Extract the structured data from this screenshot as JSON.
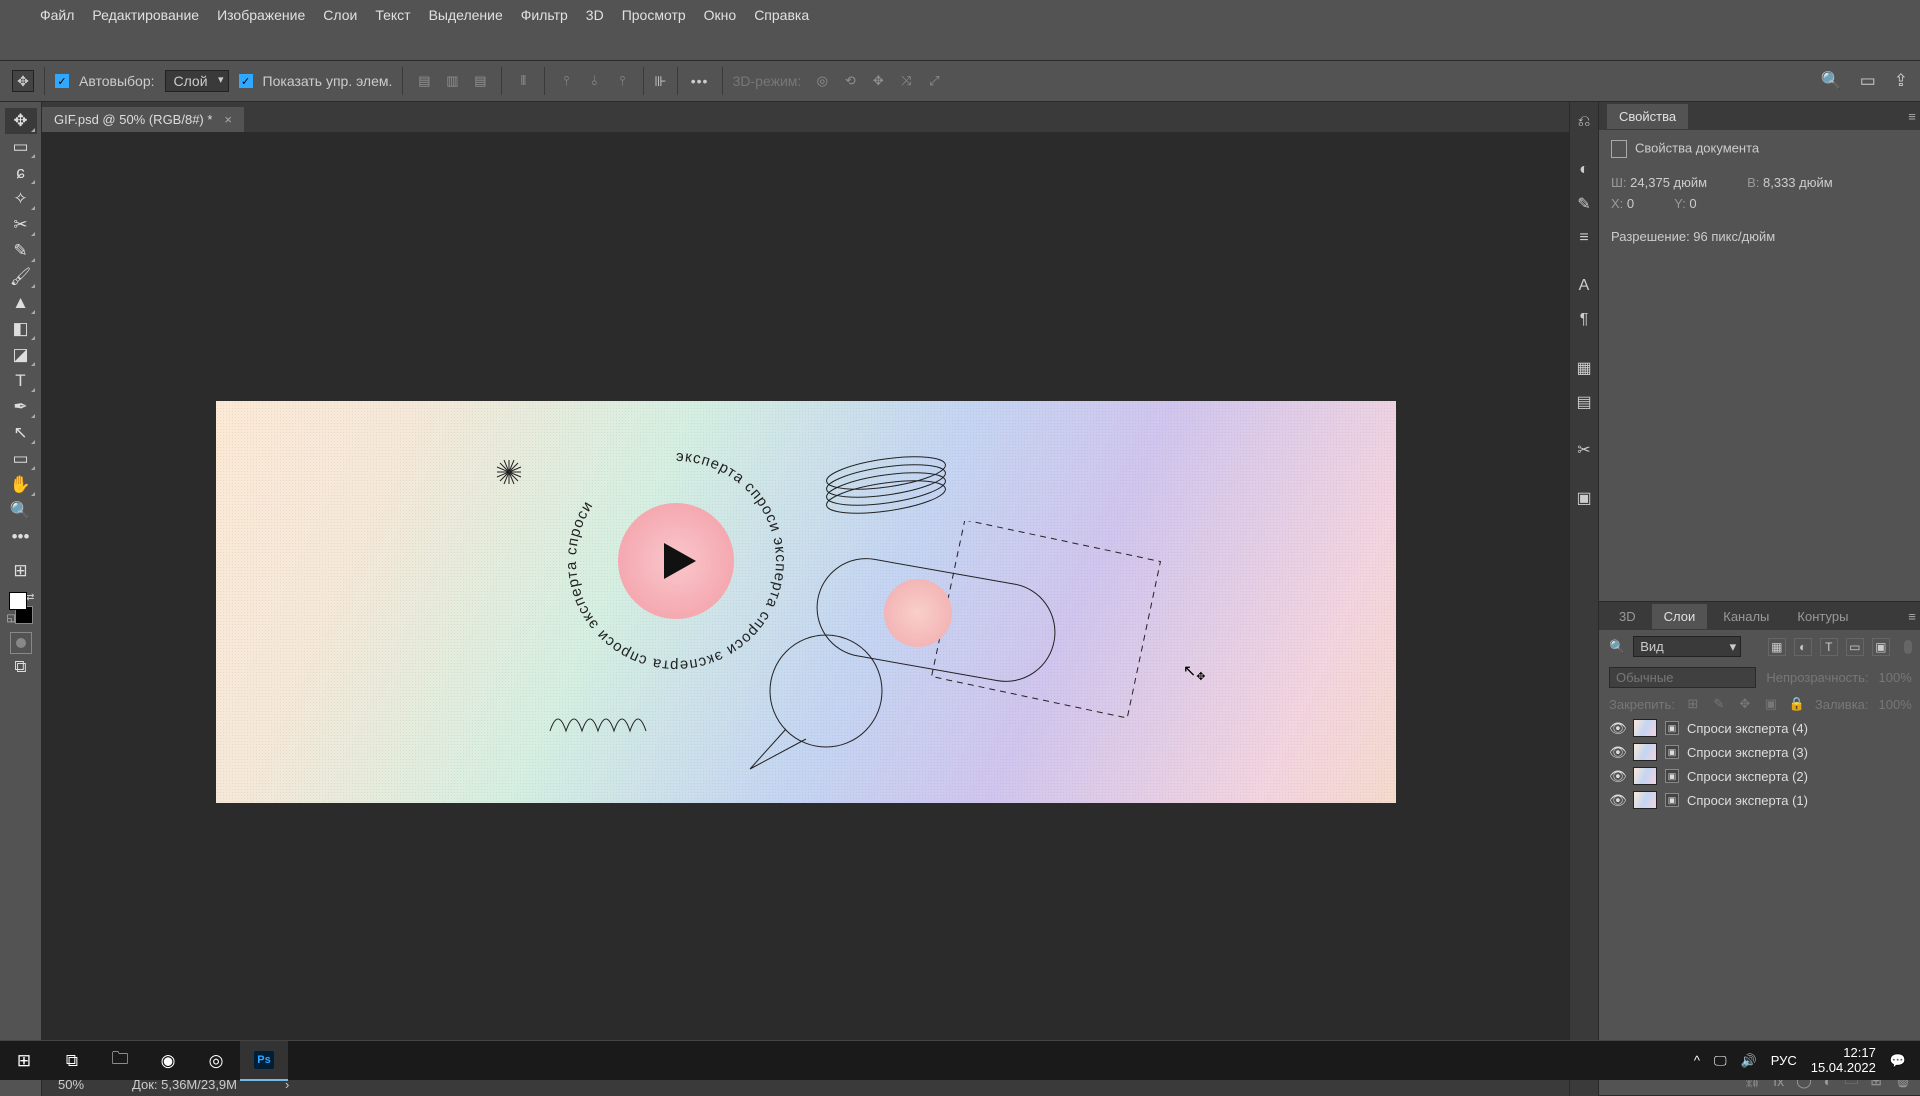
{
  "app": {
    "logo": "Ps"
  },
  "menu": [
    "Файл",
    "Редактирование",
    "Изображение",
    "Слои",
    "Текст",
    "Выделение",
    "Фильтр",
    "3D",
    "Просмотр",
    "Окно",
    "Справка"
  ],
  "optbar": {
    "autoselect": "Автовыбор:",
    "layer": "Слой",
    "showctrl": "Показать упр. элем.",
    "mode3d": "3D-режим:"
  },
  "doc": {
    "tab": "GIF.psd @ 50% (RGB/8#) *",
    "close": "×"
  },
  "status": {
    "zoom": "50%",
    "doc": "Док: 5,36M/23,9M",
    "arrow": "›"
  },
  "properties": {
    "title": "Свойства",
    "subhead": "Свойства документа",
    "w_lbl": "Ш:",
    "w_val": "24,375 дюйм",
    "h_lbl": "В:",
    "h_val": "8,333 дюйм",
    "x_lbl": "X:",
    "x_val": "0",
    "y_lbl": "Y:",
    "y_val": "0",
    "res": "Разрешение: 96 пикс/дюйм"
  },
  "layertabs": {
    "t3d": "3D",
    "layers": "Слои",
    "channels": "Каналы",
    "paths": "Контуры"
  },
  "layeropts": {
    "search": "Вид",
    "normal": "Обычные",
    "opacity": "Непрозрачность:",
    "opval": "100%",
    "lock": "Закрепить:",
    "fill": "Заливка:",
    "fillval": "100%"
  },
  "layers": [
    {
      "name": "Спроси эксперта (4)"
    },
    {
      "name": "Спроси эксперта (3)"
    },
    {
      "name": "Спроси эксперта (2)"
    },
    {
      "name": "Спроси эксперта (1)"
    }
  ],
  "circle_text": "эксперта спроси эксперта спроси эксперта спроси эксперта спроси ",
  "taskbar": {
    "lang": "РУС",
    "time": "12:17",
    "date": "15.04.2022"
  }
}
